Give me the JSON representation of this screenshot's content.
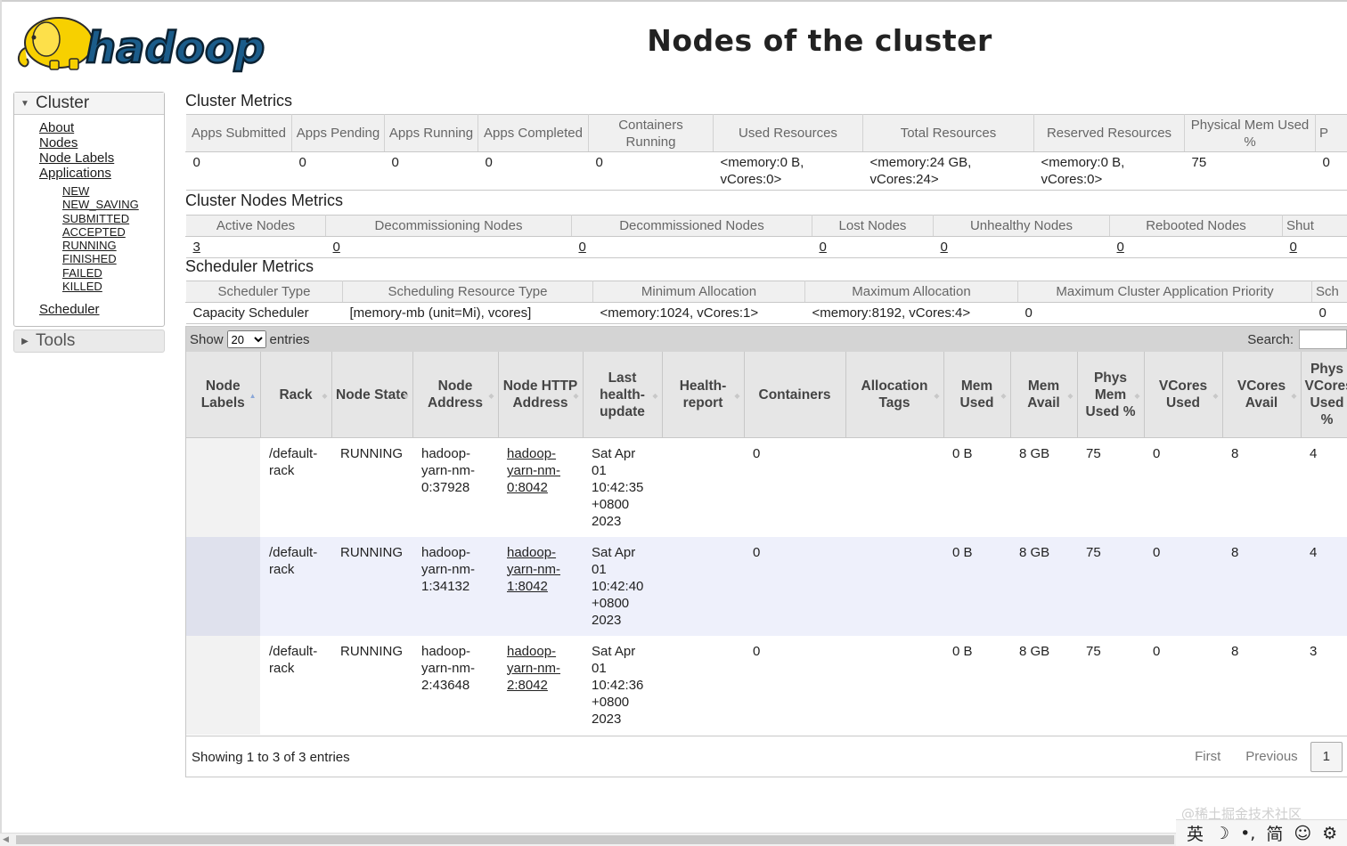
{
  "logo_text": "hadoop",
  "page_title": "Nodes of the cluster",
  "sidebar": {
    "cluster_label": "Cluster",
    "links": [
      "About",
      "Nodes",
      "Node Labels",
      "Applications"
    ],
    "app_states": [
      "NEW",
      "NEW_SAVING",
      "SUBMITTED",
      "ACCEPTED",
      "RUNNING",
      "FINISHED",
      "FAILED",
      "KILLED"
    ],
    "scheduler_label": "Scheduler",
    "tools_label": "Tools"
  },
  "cluster_metrics": {
    "title": "Cluster Metrics",
    "headers": [
      "Apps Submitted",
      "Apps Pending",
      "Apps Running",
      "Apps Completed",
      "Containers Running",
      "Used Resources",
      "Total Resources",
      "Reserved Resources",
      "Physical Mem Used %",
      "P"
    ],
    "values": [
      "0",
      "0",
      "0",
      "0",
      "0",
      "<memory:0 B, vCores:0>",
      "<memory:24 GB, vCores:24>",
      "<memory:0 B, vCores:0>",
      "75",
      "0"
    ]
  },
  "nodes_metrics": {
    "title": "Cluster Nodes Metrics",
    "headers": [
      "Active Nodes",
      "Decommissioning Nodes",
      "Decommissioned Nodes",
      "Lost Nodes",
      "Unhealthy Nodes",
      "Rebooted Nodes",
      "Shut"
    ],
    "values": [
      "3",
      "0",
      "0",
      "0",
      "0",
      "0",
      "0"
    ]
  },
  "scheduler_metrics": {
    "title": "Scheduler Metrics",
    "headers": [
      "Scheduler Type",
      "Scheduling Resource Type",
      "Minimum Allocation",
      "Maximum Allocation",
      "Maximum Cluster Application Priority",
      "Sch"
    ],
    "values": [
      "Capacity Scheduler",
      "[memory-mb (unit=Mi), vcores]",
      "<memory:1024, vCores:1>",
      "<memory:8192, vCores:4>",
      "0",
      "0"
    ]
  },
  "nodes_table": {
    "show_label": "Show",
    "page_size": "20",
    "entries_label": "entries",
    "search_label": "Search:",
    "headers": [
      "Node Labels",
      "Rack",
      "Node State",
      "Node Address",
      "Node HTTP Address",
      "Last health-update",
      "Health-report",
      "Containers",
      "Allocation Tags",
      "Mem Used",
      "Mem Avail",
      "Phys Mem Used %",
      "VCores Used",
      "VCores Avail",
      "Phys VCores Used %"
    ],
    "rows": [
      {
        "labels": "",
        "rack": "/default-rack",
        "state": "RUNNING",
        "address": "hadoop-yarn-nm-0:37928",
        "http": "hadoop-yarn-nm-0:8042",
        "health_update": "Sat Apr 01 10:42:35 +0800 2023",
        "health_report": "",
        "containers": "0",
        "tags": "",
        "mem_used": "0 B",
        "mem_avail": "8 GB",
        "phys_mem": "75",
        "vcores_used": "0",
        "vcores_avail": "8",
        "phys_vcores": "4"
      },
      {
        "labels": "",
        "rack": "/default-rack",
        "state": "RUNNING",
        "address": "hadoop-yarn-nm-1:34132",
        "http": "hadoop-yarn-nm-1:8042",
        "health_update": "Sat Apr 01 10:42:40 +0800 2023",
        "health_report": "",
        "containers": "0",
        "tags": "",
        "mem_used": "0 B",
        "mem_avail": "8 GB",
        "phys_mem": "75",
        "vcores_used": "0",
        "vcores_avail": "8",
        "phys_vcores": "4"
      },
      {
        "labels": "",
        "rack": "/default-rack",
        "state": "RUNNING",
        "address": "hadoop-yarn-nm-2:43648",
        "http": "hadoop-yarn-nm-2:8042",
        "health_update": "Sat Apr 01 10:42:36 +0800 2023",
        "health_report": "",
        "containers": "0",
        "tags": "",
        "mem_used": "0 B",
        "mem_avail": "8 GB",
        "phys_mem": "75",
        "vcores_used": "0",
        "vcores_avail": "8",
        "phys_vcores": "3"
      }
    ],
    "info": "Showing 1 to 3 of 3 entries",
    "pager": {
      "first": "First",
      "previous": "Previous",
      "current": "1"
    }
  },
  "watermark": "@稀土掘金技术社区",
  "ime": [
    "英",
    "☽",
    "•,",
    "简",
    "☺",
    "⚙"
  ]
}
